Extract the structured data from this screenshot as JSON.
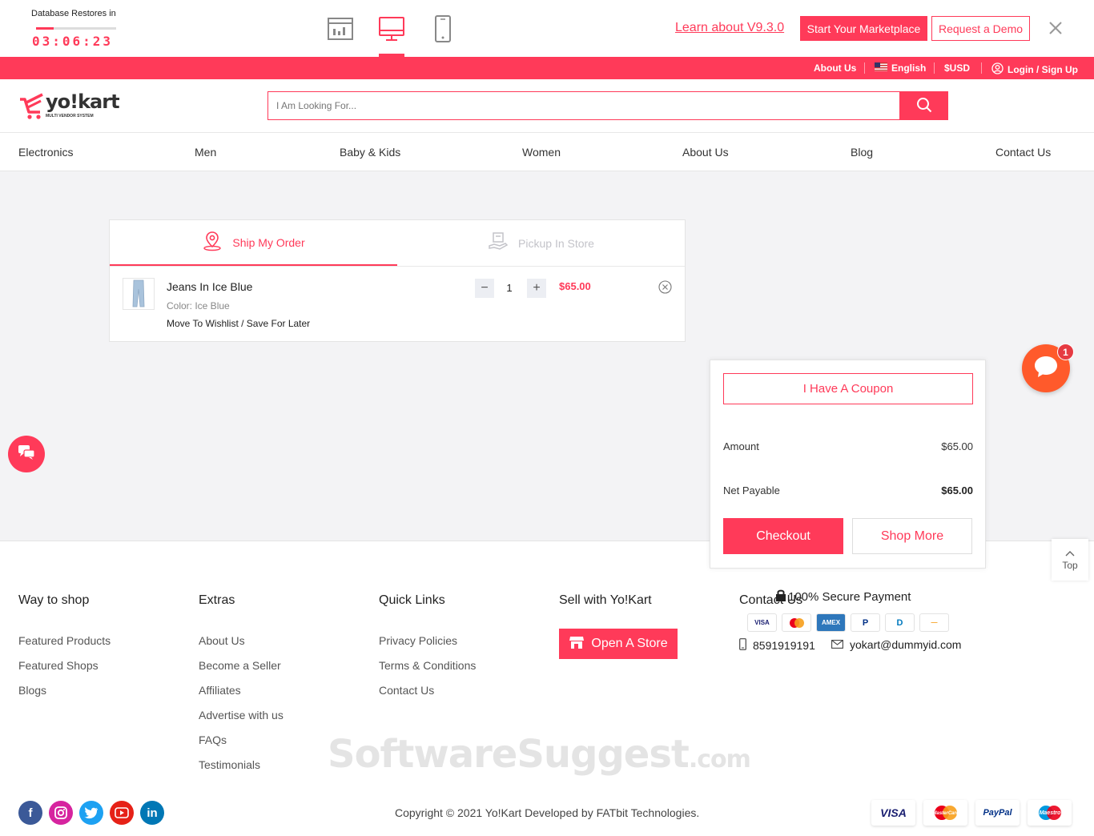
{
  "demo_bar": {
    "restore_label": "Database Restores in",
    "restore_progress": 0.22,
    "timer": "03:06:23",
    "learn_link": "Learn about V9.3.0",
    "start_marketplace": "Start Your Marketplace",
    "request_demo": "Request a Demo",
    "active_device": "desktop"
  },
  "top_strip": {
    "about": "About Us",
    "language": "English",
    "currency": "$USD",
    "login": "Login / Sign Up"
  },
  "header": {
    "logo_text": "yo!kart",
    "logo_sub": "MULTI VENDOR SYSTEM",
    "search_placeholder": "I Am Looking For..."
  },
  "nav": {
    "items": [
      "Electronics",
      "Men",
      "Baby & Kids",
      "Women",
      "About Us",
      "Blog",
      "Contact Us"
    ]
  },
  "cart": {
    "tabs": {
      "ship": "Ship My Order",
      "pickup": "Pickup In Store"
    },
    "item": {
      "name": "Jeans In Ice Blue",
      "color": "Color: Ice Blue",
      "actions": "Move To Wishlist / Save For Later",
      "quantity": "1",
      "price": "$65.00"
    }
  },
  "summary": {
    "coupon": "I Have A Coupon",
    "amount_label": "Amount",
    "amount_value": "$65.00",
    "net_label": "Net Payable",
    "net_value": "$65.00",
    "checkout": "Checkout",
    "shop_more": "Shop More"
  },
  "floating": {
    "chat_badge": "1",
    "top_label": "Top"
  },
  "footer": {
    "way_to_shop": {
      "title": "Way to shop",
      "links": [
        "Featured Products",
        "Featured Shops",
        "Blogs"
      ]
    },
    "extras": {
      "title": "Extras",
      "links": [
        "About Us",
        "Become a Seller",
        "Affiliates",
        "Advertise with us",
        "FAQs",
        "Testimonials"
      ]
    },
    "quick_links": {
      "title": "Quick Links",
      "links": [
        "Privacy Policies",
        "Terms & Conditions",
        "Contact Us"
      ]
    },
    "sell": {
      "title": "Sell with Yo!Kart",
      "open_store": "Open A Store"
    },
    "contact": {
      "title": "Contact Us",
      "phone": "8591919191",
      "email": "yokart@dummyid.com"
    },
    "secure_payment": "100% Secure Payment",
    "pay_icons": [
      "VISA",
      "MC",
      "AMEX",
      "P",
      "D",
      "—"
    ],
    "watermark": "SoftwareSuggest",
    "watermark_suffix": ".com",
    "copyright": "Copyright © 2021 Yo!Kart Developed by FATbit Technologies.",
    "bottom_pay": [
      "VISA",
      "MasterCard",
      "PayPal",
      "Maestro"
    ]
  },
  "colors": {
    "accent": "#ff3a59",
    "chat": "#ff5a2b"
  }
}
